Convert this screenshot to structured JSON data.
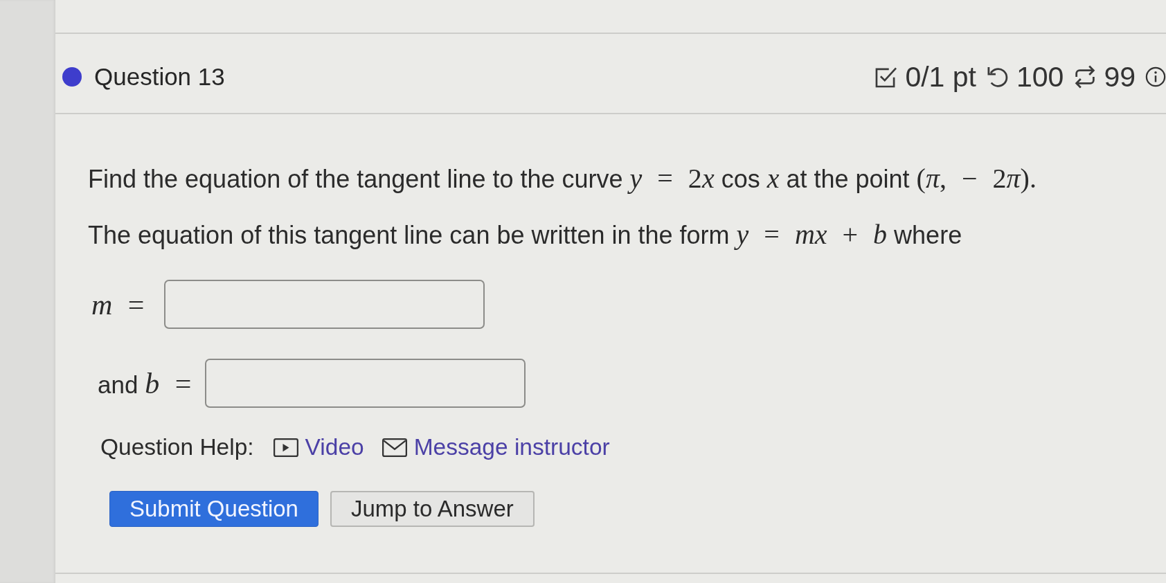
{
  "header": {
    "title": "Question 13",
    "stats": [
      {
        "kind": "score",
        "text": "0/1 pt"
      },
      {
        "kind": "attempts",
        "text": "100"
      },
      {
        "kind": "retries",
        "text": "99"
      }
    ]
  },
  "question": {
    "paragraphs": [
      [
        {
          "kind": "text",
          "text": "Find the equation of the tangent line to the curve "
        },
        {
          "kind": "var",
          "text": "y"
        },
        {
          "kind": "math",
          "text": " = 2"
        },
        {
          "kind": "var",
          "text": "x"
        },
        {
          "kind": "text",
          "text": " cos "
        },
        {
          "kind": "var",
          "text": "x"
        },
        {
          "kind": "text",
          "text": " at the point "
        },
        {
          "kind": "math",
          "text": "("
        },
        {
          "kind": "var",
          "text": "π"
        },
        {
          "kind": "math",
          "text": ", − 2"
        },
        {
          "kind": "var",
          "text": "π"
        },
        {
          "kind": "math",
          "text": ")."
        }
      ],
      [
        {
          "kind": "text",
          "text": "The equation of this tangent line can be written in the form "
        },
        {
          "kind": "var",
          "text": "y"
        },
        {
          "kind": "math",
          "text": " = "
        },
        {
          "kind": "var",
          "text": "mx"
        },
        {
          "kind": "math",
          "text": " + "
        },
        {
          "kind": "var",
          "text": "b"
        },
        {
          "kind": "text",
          "text": " where"
        }
      ]
    ]
  },
  "answers": [
    {
      "label": [
        {
          "kind": "var",
          "text": "m"
        },
        {
          "kind": "math",
          "text": " ="
        }
      ]
    },
    {
      "label": [
        {
          "kind": "text",
          "text": "and "
        },
        {
          "kind": "var",
          "text": "b"
        },
        {
          "kind": "math",
          "text": " ="
        }
      ]
    }
  ],
  "help": {
    "label": "Question Help:",
    "links": [
      {
        "kind": "video",
        "text": "Video"
      },
      {
        "kind": "message",
        "text": "Message instructor"
      }
    ]
  },
  "buttons": [
    {
      "kind": "primary",
      "text": "Submit Question"
    },
    {
      "kind": "secondary",
      "text": "Jump to Answer"
    }
  ]
}
